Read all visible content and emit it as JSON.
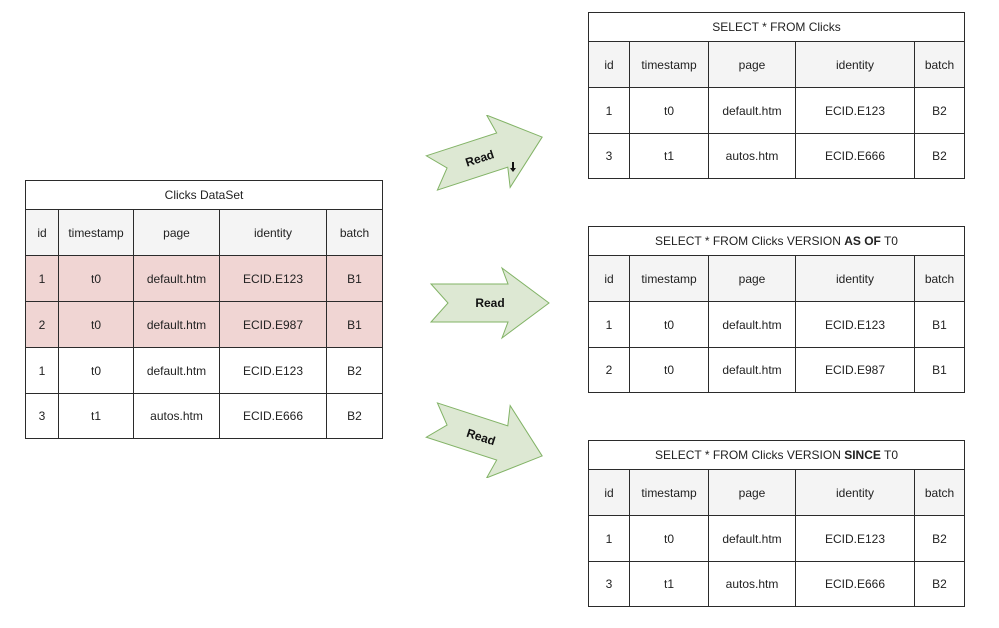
{
  "columns": [
    "id",
    "timestamp",
    "page",
    "identity",
    "batch"
  ],
  "dataset": {
    "title": "Clicks DataSet",
    "rows": [
      {
        "id": "1",
        "timestamp": "t0",
        "page": "default.htm",
        "identity": "ECID.E123",
        "batch": "B1",
        "highlighted": true
      },
      {
        "id": "2",
        "timestamp": "t0",
        "page": "default.htm",
        "identity": "ECID.E987",
        "batch": "B1",
        "highlighted": true
      },
      {
        "id": "1",
        "timestamp": "t0",
        "page": "default.htm",
        "identity": "ECID.E123",
        "batch": "B2",
        "highlighted": false
      },
      {
        "id": "3",
        "timestamp": "t1",
        "page": "autos.htm",
        "identity": "ECID.E666",
        "batch": "B2",
        "highlighted": false
      }
    ]
  },
  "arrows": [
    {
      "label": "Read"
    },
    {
      "label": "Read"
    },
    {
      "label": "Read"
    }
  ],
  "queries": [
    {
      "title_pre": "SELECT * FROM Clicks",
      "title_bold": "",
      "title_post": "",
      "rows": [
        {
          "id": "1",
          "timestamp": "t0",
          "page": "default.htm",
          "identity": "ECID.E123",
          "batch": "B2"
        },
        {
          "id": "3",
          "timestamp": "t1",
          "page": "autos.htm",
          "identity": "ECID.E666",
          "batch": "B2"
        }
      ]
    },
    {
      "title_pre": "SELECT * FROM Clicks VERSION ",
      "title_bold": "AS OF",
      "title_post": " T0",
      "rows": [
        {
          "id": "1",
          "timestamp": "t0",
          "page": "default.htm",
          "identity": "ECID.E123",
          "batch": "B1"
        },
        {
          "id": "2",
          "timestamp": "t0",
          "page": "default.htm",
          "identity": "ECID.E987",
          "batch": "B1"
        }
      ]
    },
    {
      "title_pre": "SELECT * FROM Clicks VERSION ",
      "title_bold": "SINCE",
      "title_post": " T0",
      "rows": [
        {
          "id": "1",
          "timestamp": "t0",
          "page": "default.htm",
          "identity": "ECID.E123",
          "batch": "B2"
        },
        {
          "id": "3",
          "timestamp": "t1",
          "page": "autos.htm",
          "identity": "ECID.E666",
          "batch": "B2"
        }
      ]
    }
  ],
  "colors": {
    "highlight_row": "#f0d5d3",
    "header_bg": "#f4f4f4",
    "arrow_fill": "#dde8d3",
    "arrow_stroke": "#82b366"
  }
}
